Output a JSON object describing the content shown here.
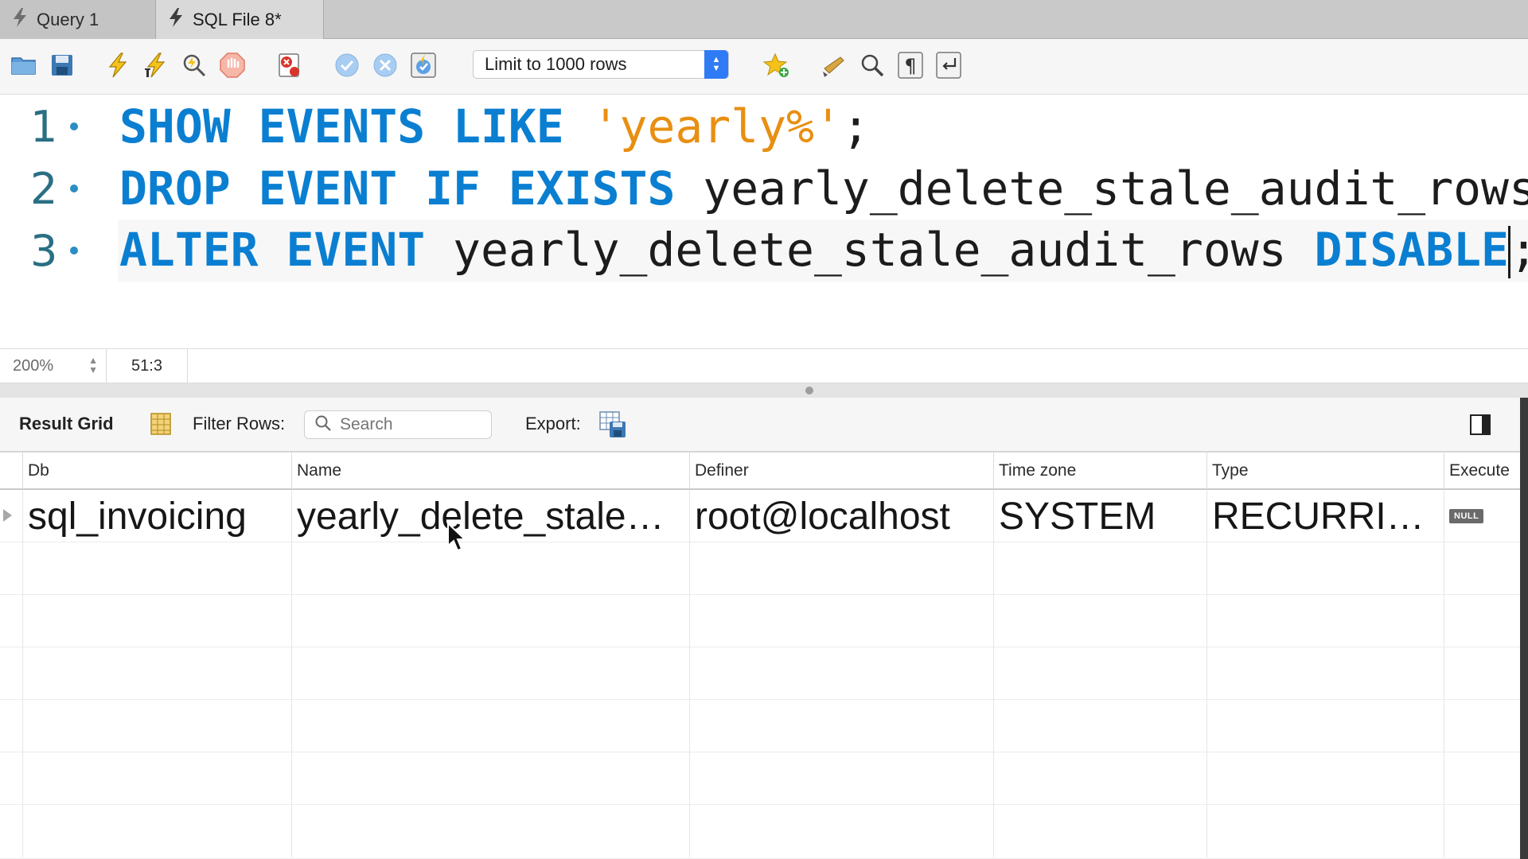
{
  "tabs": [
    {
      "label": "Query 1",
      "active": false
    },
    {
      "label": "SQL File 8*",
      "active": true
    }
  ],
  "toolbar": {
    "icons": [
      "open-folder-icon",
      "save-icon",
      "execute-icon",
      "execute-current-icon",
      "explain-icon",
      "stop-icon",
      "toggle-error-icon",
      "commit-icon",
      "rollback-icon",
      "autocommit-icon",
      "bookmark-icon",
      "beautify-icon",
      "find-icon",
      "invisible-chars-icon",
      "wrap-icon"
    ],
    "limit_select": "Limit to 1000 rows"
  },
  "editor": {
    "lines": [
      {
        "number": "1",
        "tokens": [
          {
            "t": "SHOW EVENTS LIKE",
            "k": "kw"
          },
          {
            "t": " ",
            "k": "plain"
          },
          {
            "t": "'yearly%'",
            "k": "str"
          },
          {
            "t": ";",
            "k": "plain"
          }
        ]
      },
      {
        "number": "2",
        "tokens": [
          {
            "t": "DROP EVENT IF EXISTS",
            "k": "kw"
          },
          {
            "t": " yearly_delete_stale_audit_rows;",
            "k": "plain"
          }
        ]
      },
      {
        "number": "3",
        "tokens": [
          {
            "t": "ALTER EVENT",
            "k": "kw"
          },
          {
            "t": " yearly_delete_stale_audit_rows ",
            "k": "plain"
          },
          {
            "t": "DISABLE",
            "k": "kw"
          },
          {
            "t": ";",
            "k": "plain"
          }
        ]
      }
    ]
  },
  "status": {
    "zoom": "200%",
    "position": "51:3"
  },
  "result": {
    "title": "Result Grid",
    "filter_label": "Filter Rows:",
    "search_placeholder": "Search",
    "export_label": "Export:",
    "columns": [
      "Db",
      "Name",
      "Definer",
      "Time zone",
      "Type",
      "Execute"
    ],
    "rows": [
      [
        "sql_invoicing",
        "yearly_delete_stale…",
        "root@localhost",
        "SYSTEM",
        "RECURRI…",
        "NULL"
      ]
    ]
  },
  "colors": {
    "keyword": "#0a7fd1",
    "string": "#e88f12",
    "line_number": "#2a6f84",
    "accent": "#2f7bf5"
  }
}
